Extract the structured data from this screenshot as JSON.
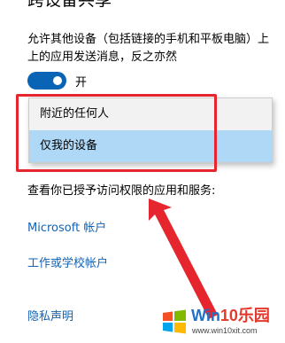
{
  "section": {
    "heading": "跨设备共享",
    "description_line1": "允许其他设备（包括链接的手机和平板电脑）上",
    "description_line2": "上的应用发送消息，反之亦然"
  },
  "toggle": {
    "state_label": "开",
    "on": true
  },
  "dropdown": {
    "options": [
      {
        "label": "附近的任何人",
        "selected": false
      },
      {
        "label": "仅我的设备",
        "selected": true
      }
    ]
  },
  "apps": {
    "heading": "查看你已授予访问权限的应用和服务:",
    "links": {
      "microsoft_account": "Microsoft 帐户",
      "work_school_account": "工作或学校帐户",
      "privacy_statement": "隐私声明"
    }
  },
  "watermark": {
    "brand_win": "Win",
    "brand_ten": "10",
    "brand_cn": "乐园",
    "url": "www.win10xit.com"
  },
  "colors": {
    "accent": "#0a64b6",
    "selected_option": "#aed8f6",
    "link": "#1263b5",
    "annotation_red": "#e5262e"
  }
}
